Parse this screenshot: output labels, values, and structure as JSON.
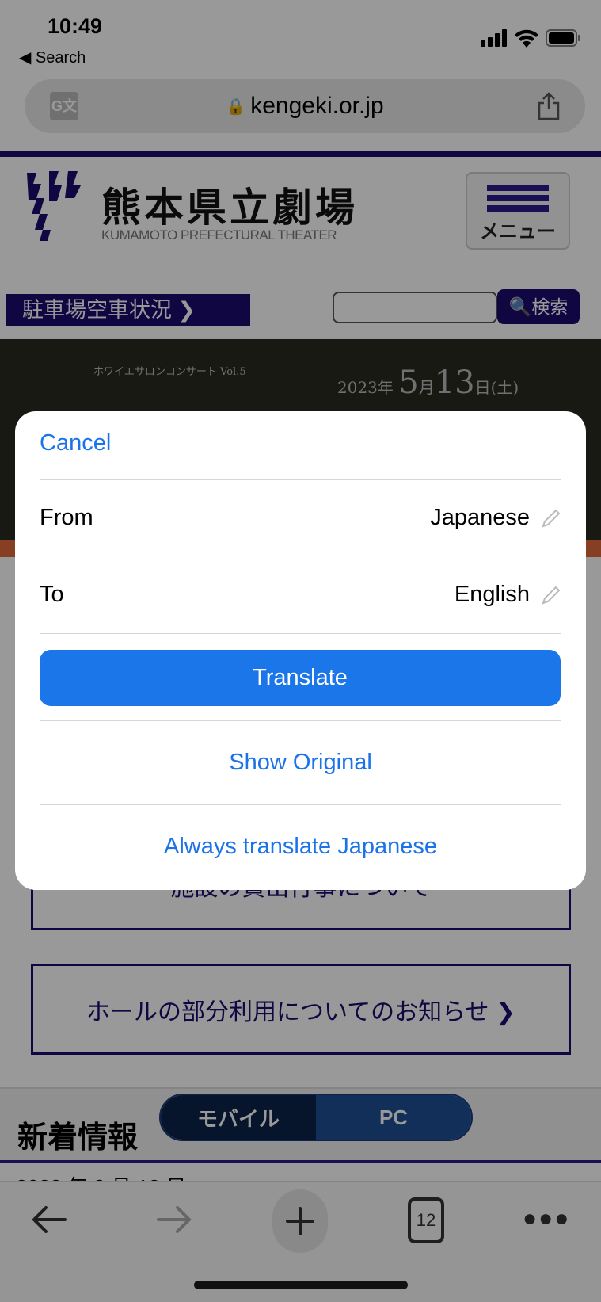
{
  "status_bar": {
    "time": "10:49",
    "back_label": "Search"
  },
  "browser": {
    "url": "kengeki.or.jp",
    "translate_icon_text": "G文",
    "tab_count": "12"
  },
  "page": {
    "logo_title": "熊本県立劇場",
    "logo_subtitle": "KUMAMOTO PREFECTURAL THEATER",
    "menu_label": "メニュー",
    "parking_label": "駐車場空車状況 ❯",
    "search_button": "検索",
    "banner_subtitle": "ホワイエサロンコンサート Vol.5",
    "banner_date_year": "2023年",
    "banner_date_month": "5",
    "banner_date_m": "月",
    "banner_date_day": "13",
    "banner_date_suffix": "日(土)",
    "link1": "施設の貸出行事について",
    "link2": "ホールの部分利用についてのお知らせ ❯",
    "news_title": "新着情報",
    "toggle": [
      "モバイル",
      "PC"
    ],
    "news_date": "2023 年 3 月 18 日"
  },
  "translate_sheet": {
    "cancel": "Cancel",
    "from_label": "From",
    "from_value": "Japanese",
    "to_label": "To",
    "to_value": "English",
    "translate": "Translate",
    "show_original": "Show Original",
    "always": "Always translate Japanese"
  },
  "colors": {
    "accent": "#1a73e8",
    "brand": "#1a0a6e"
  }
}
